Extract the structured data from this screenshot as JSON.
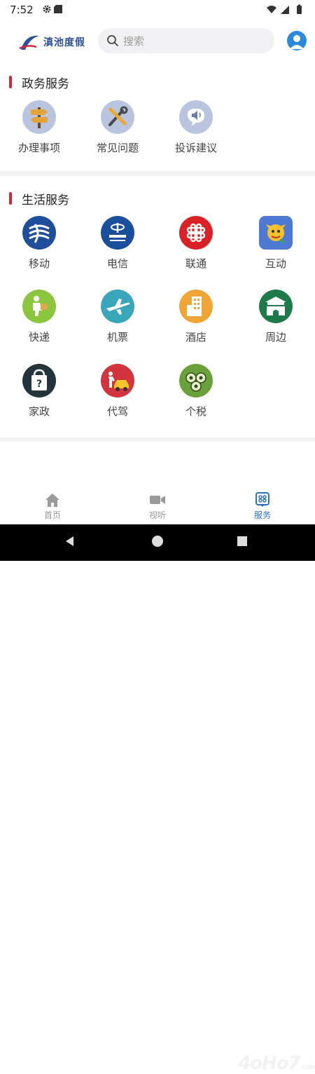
{
  "status_bar": {
    "time": "7:52"
  },
  "header": {
    "logo_text": "滇池度假",
    "search_placeholder": "搜索"
  },
  "sections": [
    {
      "title": "政务服务",
      "items": [
        {
          "label": "办理事项",
          "icon": "signpost-icon"
        },
        {
          "label": "常见问题",
          "icon": "tools-icon"
        },
        {
          "label": "投诉建议",
          "icon": "megaphone-icon"
        }
      ]
    },
    {
      "title": "生活服务",
      "items": [
        {
          "label": "移动",
          "icon": "china-mobile-icon"
        },
        {
          "label": "电信",
          "icon": "china-telecom-icon"
        },
        {
          "label": "联通",
          "icon": "china-unicom-icon"
        },
        {
          "label": "互动",
          "icon": "dragon-icon"
        },
        {
          "label": "快递",
          "icon": "courier-icon"
        },
        {
          "label": "机票",
          "icon": "airplane-icon"
        },
        {
          "label": "酒店",
          "icon": "hotel-icon"
        },
        {
          "label": "周边",
          "icon": "gate-icon"
        },
        {
          "label": "家政",
          "icon": "housekeeping-icon"
        },
        {
          "label": "代驾",
          "icon": "chauffeur-icon"
        },
        {
          "label": "个税",
          "icon": "coins-icon"
        }
      ]
    }
  ],
  "tab_bar": {
    "tabs": [
      {
        "label": "首页",
        "icon": "home-icon",
        "active": false
      },
      {
        "label": "视听",
        "icon": "video-icon",
        "active": false
      },
      {
        "label": "服务",
        "icon": "service-icon",
        "active": true
      }
    ],
    "active_color": "#2a72c9",
    "inactive_color": "#9a9a9a"
  },
  "watermark": {
    "text": "4oHo7",
    "suffix": ".com"
  },
  "colors": {
    "section_accent": "#d0283b",
    "brand": "#2c4fa0"
  }
}
